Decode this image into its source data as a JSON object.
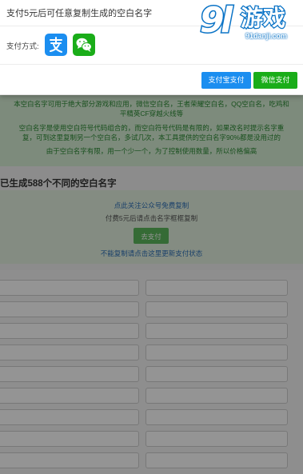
{
  "dialog": {
    "title": "支付5元后可任意复制生成的空白名字",
    "method_label": "支付方式:",
    "alipay_button": "支付宝支付",
    "wechat_button": "微信支付"
  },
  "info": {
    "lines": [
      "本空白名字可用于绝大部分游戏和应用，微信空白名，王者荣耀空白名，QQ空白名，吃鸡和",
      "平精英CF穿越火线等",
      "空白名字是使用空白符号代码组合的，而空白符号代码是有限的，如果改名时提示名字重",
      "复，可到这里复制另一个空白名，多试几次，本工具提供的空白名字90%都是没用过的",
      "由于空白名字有限，用一个少一个，为了控制使用数量，所以价格偏高"
    ]
  },
  "count_title": "已生成588个不同的空白名字",
  "pay": {
    "follow_link": "点此关注公众号免费复制",
    "pay_hint": "付费5元后请点击名字框框复制",
    "go_pay": "去支付",
    "refresh_link": "不能复制请点击这里更新支付状态"
  },
  "watermark": {
    "logo_text": "游戏",
    "site": "91danji.com"
  }
}
